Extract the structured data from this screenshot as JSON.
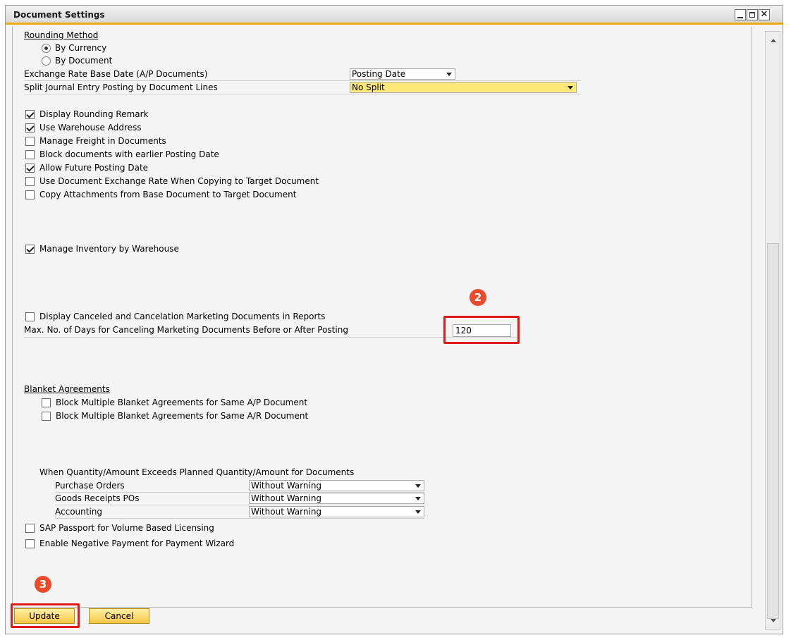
{
  "window": {
    "title": "Document Settings"
  },
  "rounding": {
    "heading": "Rounding Method",
    "options": [
      "By Currency",
      "By Document"
    ],
    "selected": "By Currency"
  },
  "exchange_rate": {
    "label": "Exchange Rate Base Date (A/P Documents)",
    "value": "Posting Date"
  },
  "split_journal": {
    "label": "Split Journal Entry Posting by Document Lines",
    "value": "No Split"
  },
  "checks_group1": [
    {
      "label": "Display Rounding Remark",
      "checked": true
    },
    {
      "label": "Use Warehouse Address",
      "checked": true
    },
    {
      "label": "Manage Freight in Documents",
      "checked": false
    },
    {
      "label": "Block documents with earlier Posting Date",
      "checked": false
    },
    {
      "label": "Allow Future Posting Date",
      "checked": true
    },
    {
      "label": "Use Document Exchange Rate When Copying to Target Document",
      "checked": false
    },
    {
      "label": "Copy Attachments from Base Document to Target Document",
      "checked": false
    }
  ],
  "manage_inventory": {
    "label": "Manage Inventory by Warehouse",
    "checked": true
  },
  "canceled_docs": {
    "label": "Display Canceled and Cancelation Marketing Documents in Reports",
    "checked": false
  },
  "max_days": {
    "label": "Max. No. of Days for Canceling Marketing Documents Before or After Posting",
    "value": "120"
  },
  "blanket": {
    "heading": "Blanket Agreements",
    "items": [
      {
        "label": "Block Multiple Blanket Agreements for Same A/P Document",
        "checked": false
      },
      {
        "label": "Block Multiple Blanket Agreements for Same A/R Document",
        "checked": false
      }
    ]
  },
  "exceeds": {
    "heading": "When Quantity/Amount Exceeds Planned Quantity/Amount for Documents",
    "rows": [
      {
        "label": "Purchase Orders",
        "value": "Without Warning"
      },
      {
        "label": "Goods Receipts POs",
        "value": "Without Warning"
      },
      {
        "label": "Accounting",
        "value": "Without Warning"
      }
    ]
  },
  "sap_passport": {
    "label": "SAP Passport for Volume Based Licensing",
    "checked": false
  },
  "negative_payment": {
    "label": "Enable Negative Payment for Payment Wizard",
    "checked": false
  },
  "buttons": {
    "update": "Update",
    "cancel": "Cancel"
  },
  "badges": {
    "two": "2",
    "three": "3"
  },
  "colors": {
    "accent": "#f0ab00",
    "highlight": "#e01919",
    "badge": "#ea4b2a",
    "field_yellow": "#fce876"
  }
}
